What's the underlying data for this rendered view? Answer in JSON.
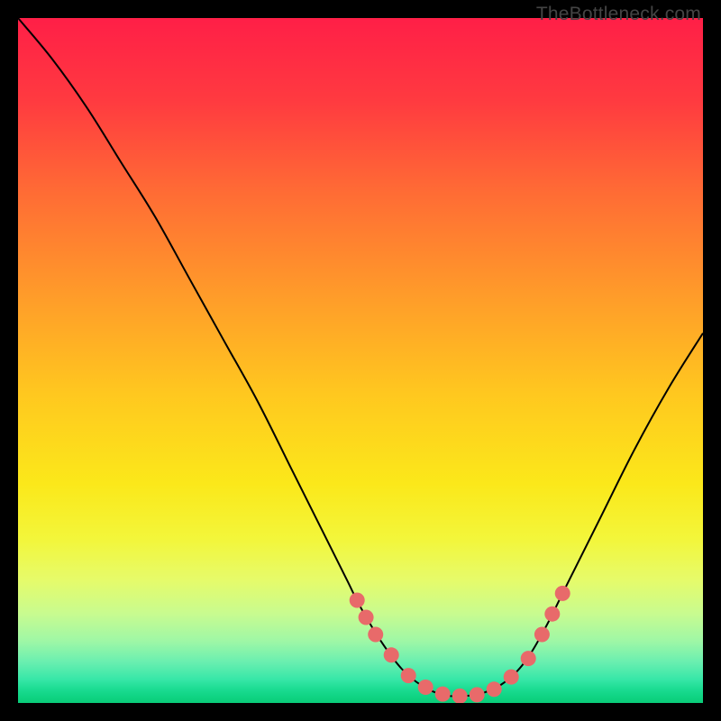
{
  "watermark": "TheBottleneck.com",
  "chart_data": {
    "type": "line",
    "title": "",
    "xlabel": "",
    "ylabel": "",
    "xlim": [
      0,
      100
    ],
    "ylim": [
      0,
      100
    ],
    "curve": [
      {
        "x": 0,
        "y": 100
      },
      {
        "x": 5,
        "y": 94
      },
      {
        "x": 10,
        "y": 87
      },
      {
        "x": 15,
        "y": 79
      },
      {
        "x": 20,
        "y": 71
      },
      {
        "x": 25,
        "y": 62
      },
      {
        "x": 30,
        "y": 53
      },
      {
        "x": 35,
        "y": 44
      },
      {
        "x": 40,
        "y": 34
      },
      {
        "x": 45,
        "y": 24
      },
      {
        "x": 48,
        "y": 18
      },
      {
        "x": 50,
        "y": 14
      },
      {
        "x": 53,
        "y": 9
      },
      {
        "x": 56,
        "y": 5
      },
      {
        "x": 59,
        "y": 2.5
      },
      {
        "x": 62,
        "y": 1.2
      },
      {
        "x": 65,
        "y": 1
      },
      {
        "x": 68,
        "y": 1.5
      },
      {
        "x": 71,
        "y": 3
      },
      {
        "x": 74,
        "y": 6
      },
      {
        "x": 77,
        "y": 11
      },
      {
        "x": 80,
        "y": 17
      },
      {
        "x": 85,
        "y": 27
      },
      {
        "x": 90,
        "y": 37
      },
      {
        "x": 95,
        "y": 46
      },
      {
        "x": 100,
        "y": 54
      }
    ],
    "markers": [
      {
        "x": 49.5,
        "y": 15
      },
      {
        "x": 50.8,
        "y": 12.5
      },
      {
        "x": 52.2,
        "y": 10
      },
      {
        "x": 54.5,
        "y": 7
      },
      {
        "x": 57,
        "y": 4
      },
      {
        "x": 59.5,
        "y": 2.3
      },
      {
        "x": 62,
        "y": 1.3
      },
      {
        "x": 64.5,
        "y": 1
      },
      {
        "x": 67,
        "y": 1.2
      },
      {
        "x": 69.5,
        "y": 2
      },
      {
        "x": 72,
        "y": 3.8
      },
      {
        "x": 74.5,
        "y": 6.5
      },
      {
        "x": 76.5,
        "y": 10
      },
      {
        "x": 78,
        "y": 13
      },
      {
        "x": 79.5,
        "y": 16
      }
    ],
    "gradient_stops": [
      {
        "offset": 0,
        "color": "#ff1f47"
      },
      {
        "offset": 12,
        "color": "#ff3a40"
      },
      {
        "offset": 25,
        "color": "#ff6a35"
      },
      {
        "offset": 40,
        "color": "#ff9a2a"
      },
      {
        "offset": 55,
        "color": "#ffc81f"
      },
      {
        "offset": 68,
        "color": "#fbe81a"
      },
      {
        "offset": 76,
        "color": "#f3f63a"
      },
      {
        "offset": 82,
        "color": "#e6fb6a"
      },
      {
        "offset": 87,
        "color": "#c8fb90"
      },
      {
        "offset": 91,
        "color": "#9ef7a6"
      },
      {
        "offset": 94,
        "color": "#6aefb0"
      },
      {
        "offset": 96.5,
        "color": "#38e7a8"
      },
      {
        "offset": 98,
        "color": "#1bdc92"
      },
      {
        "offset": 99,
        "color": "#10d484"
      },
      {
        "offset": 100,
        "color": "#0acc78"
      }
    ],
    "marker_color": "#e86a6a",
    "curve_color": "#000000"
  }
}
